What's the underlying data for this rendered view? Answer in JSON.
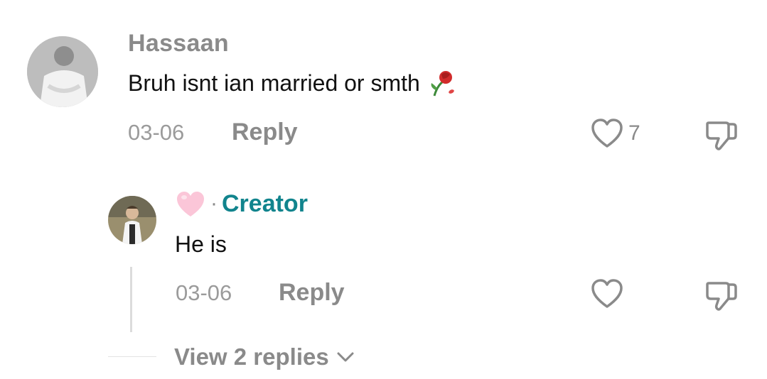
{
  "comment": {
    "username": "Hassaan",
    "text": "Bruh isnt ian married or smth",
    "emoji_icon": "wilted-rose-icon",
    "date": "03-06",
    "reply_label": "Reply",
    "like_count": "7",
    "avatar_icon": "user-avatar-photo"
  },
  "reply": {
    "username_icon": "pink-heart-icon",
    "separator": "·",
    "badge": "Creator",
    "text": "He is",
    "date": "03-06",
    "reply_label": "Reply",
    "avatar_icon": "creator-avatar-photo"
  },
  "view_replies": {
    "label": "View 2 replies"
  },
  "colors": {
    "creator_teal": "#11848d",
    "muted_gray": "#8a8a8a",
    "text_black": "#111111"
  }
}
